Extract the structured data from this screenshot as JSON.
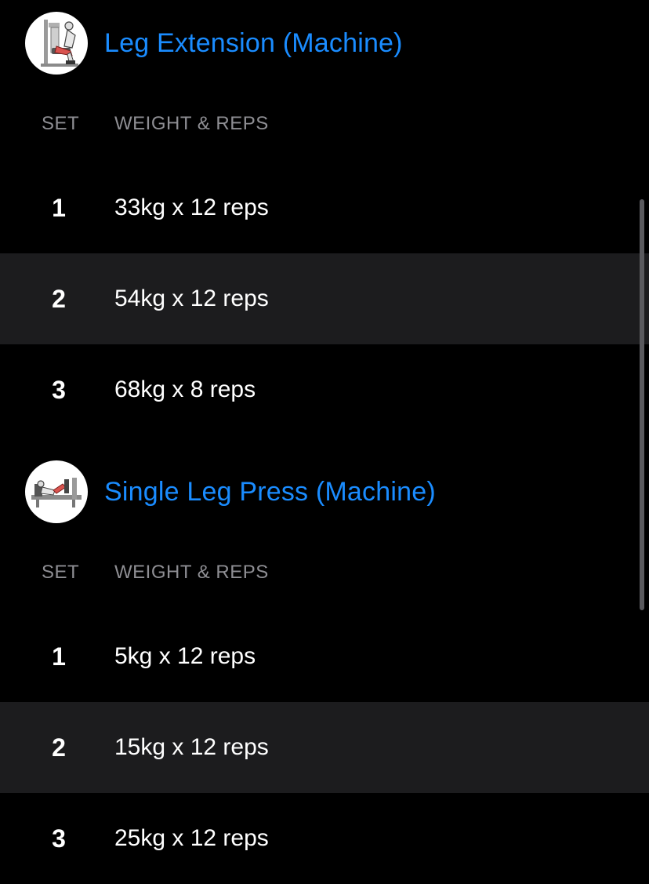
{
  "accent_color": "#1a8cff",
  "row_alt_color": "#1c1c1e",
  "exercises": [
    {
      "name": "Leg Extension (Machine)",
      "thumbnail_icon": "leg-extension-machine-icon",
      "columns": {
        "set": "SET",
        "weight_reps": "WEIGHT & REPS"
      },
      "sets": [
        {
          "number": "1",
          "value": "33kg x 12 reps"
        },
        {
          "number": "2",
          "value": "54kg x 12 reps"
        },
        {
          "number": "3",
          "value": "68kg x 8 reps"
        }
      ]
    },
    {
      "name": "Single Leg Press (Machine)",
      "thumbnail_icon": "leg-press-machine-icon",
      "columns": {
        "set": "SET",
        "weight_reps": "WEIGHT & REPS"
      },
      "sets": [
        {
          "number": "1",
          "value": "5kg x 12 reps"
        },
        {
          "number": "2",
          "value": "15kg x 12 reps"
        },
        {
          "number": "3",
          "value": "25kg x 12 reps"
        }
      ]
    }
  ]
}
